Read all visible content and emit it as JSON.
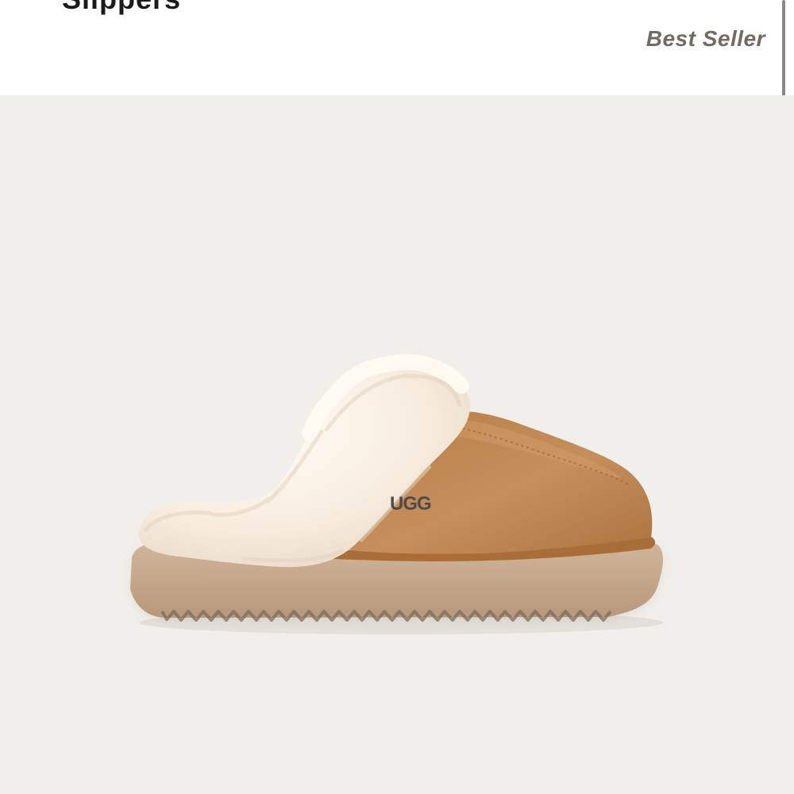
{
  "header": {
    "partial_title": "Slippers",
    "badge_text": "Best Seller"
  },
  "product_image": {
    "alt": "Chestnut suede platform slipper with sheepskin collar",
    "logo_text": "UGG"
  },
  "colors": {
    "page_bg": "#ffffff",
    "image_bg": "#f1efeb",
    "badge_text": "#726b63",
    "scrollbar": "#898989",
    "suede": "#b98553",
    "sole": "#c7ab8e",
    "fur": "#f6ecdc",
    "logo": "#4f4b4d"
  }
}
